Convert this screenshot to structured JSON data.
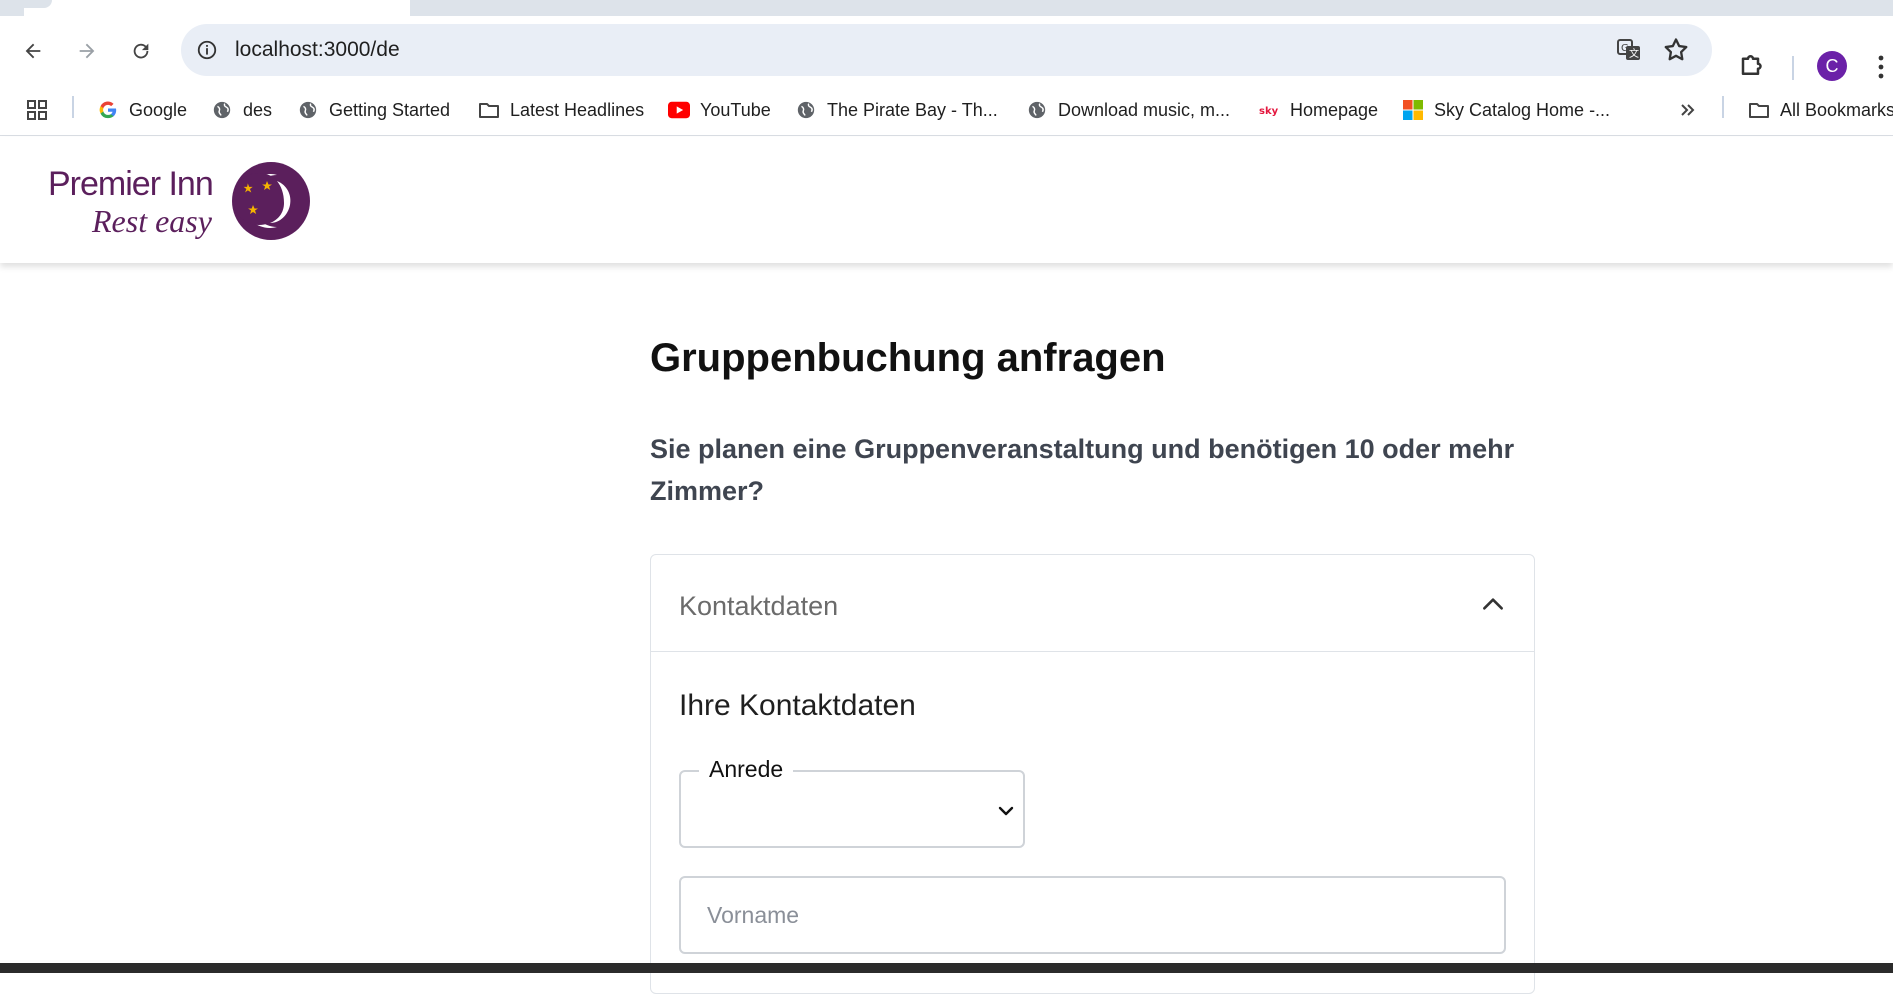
{
  "browser": {
    "url": "localhost:3000/de",
    "avatar_letter": "C",
    "bookmarks": [
      {
        "label": "Google",
        "icon": "google-icon"
      },
      {
        "label": "des",
        "icon": "globe-icon"
      },
      {
        "label": "Getting Started",
        "icon": "globe-icon"
      },
      {
        "label": "Latest Headlines",
        "icon": "folder-icon"
      },
      {
        "label": "YouTube",
        "icon": "youtube-icon"
      },
      {
        "label": "The Pirate Bay - Th...",
        "icon": "globe-icon"
      },
      {
        "label": "Download music, m...",
        "icon": "globe-icon"
      },
      {
        "label": "Homepage",
        "icon": "sky-icon"
      },
      {
        "label": "Sky Catalog Home -...",
        "icon": "microsoft-icon"
      }
    ],
    "all_bookmarks_label": "All Bookmarks"
  },
  "header": {
    "brand": "Premier Inn",
    "tagline": "Rest easy",
    "brand_color": "#5b1f5c"
  },
  "main": {
    "title": "Gruppenbuchung anfragen",
    "intro": "Sie planen eine Gruppenveranstaltung und benötigen 10 oder mehr Zimmer?",
    "accordion": {
      "label": "Kontaktdaten",
      "section_title": "Ihre Kontaktdaten",
      "salutation_label": "Anrede",
      "salutation_value": "",
      "first_name_placeholder": "Vorname"
    }
  }
}
